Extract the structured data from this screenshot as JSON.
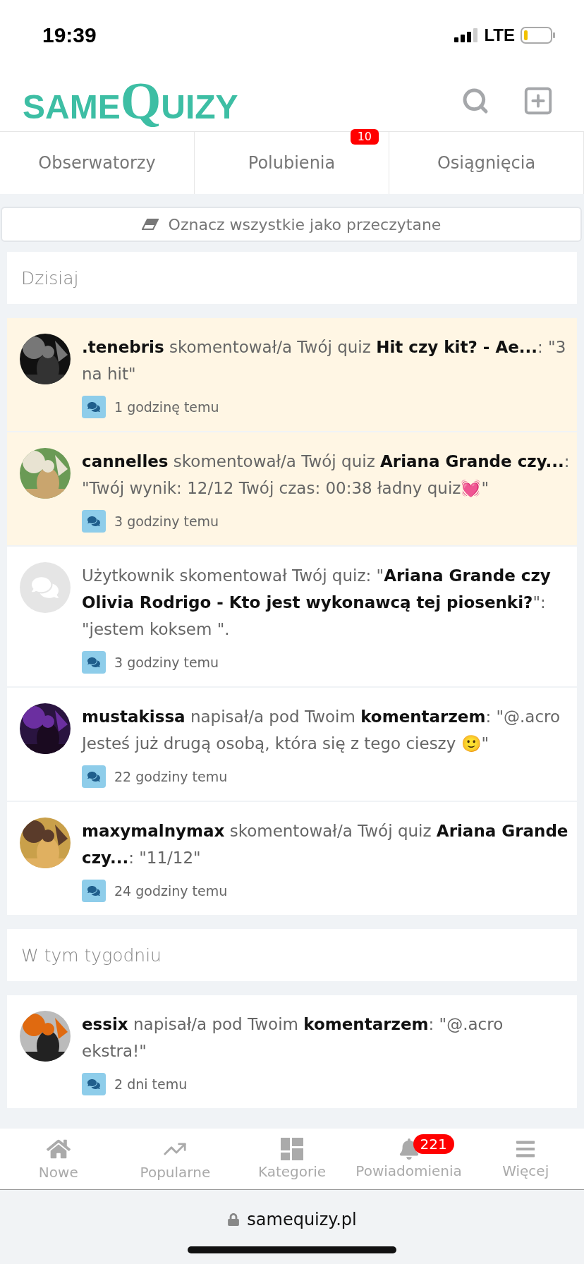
{
  "status_bar": {
    "time": "19:39",
    "network": "LTE"
  },
  "header": {
    "logo": [
      "SAME",
      "Q",
      "UIZY"
    ]
  },
  "tabs": [
    {
      "label": "Obserwatorzy",
      "selected": false
    },
    {
      "label": "Polubienia",
      "selected": false,
      "badge": "10"
    },
    {
      "label": "Osiągnięcia",
      "selected": false
    }
  ],
  "mark_all_button": "Oznacz wszystkie jako przeczytane",
  "sections": [
    {
      "title": "Dzisiaj",
      "items": [
        {
          "unread": true,
          "text": "**.tenebris** skomentował/a Twój quiz **Hit czy kit? - Ae...**: \"3 na hit\"",
          "time": "1 godzinę temu"
        },
        {
          "unread": true,
          "text": "**cannelles** skomentował/a Twój quiz **Ariana Grande czy...**: \"Twój wynik: 12/12 Twój czas: 00:38 ładny quiz💓\"",
          "time": "3 godziny temu"
        },
        {
          "avatar": {
            "kind": "placeholder"
          },
          "unread": false,
          "text": "Użytkownik skomentował Twój quiz: \"**Ariana Grande czy Olivia Rodrigo - Kto jest wykonawcą tej piosenki?**\": \"jestem koksem \".",
          "time": "3 godziny temu"
        },
        {
          "unread": false,
          "text": "**mustakissa** napisał/a pod Twoim **komentarzem**: \"@.acro Jesteś już drugą osobą, która się z tego cieszy 🙂\"",
          "time": "22 godziny temu"
        },
        {
          "unread": false,
          "text": "**maxymalnymax** skomentował/a Twój quiz **Ariana Grande czy...**: \"11/12\"",
          "time": "24 godziny temu"
        }
      ]
    },
    {
      "title": "W tym tygodniu",
      "items": [
        {
          "unread": false,
          "text": "**essix** napisał/a pod Twoim **komentarzem**: \"@.acro ekstra!\"",
          "time": "2 dni temu"
        }
      ]
    }
  ],
  "bottom_nav": [
    {
      "label": "Nowe",
      "selected": false
    },
    {
      "label": "Popularne",
      "selected": false
    },
    {
      "label": "Kategorie",
      "selected": false
    },
    {
      "label": "Powiadomienia",
      "selected": false,
      "badge": "221"
    },
    {
      "label": "Więcej",
      "selected": false
    }
  ],
  "browser_bar": {
    "url": "samequizy.pl"
  }
}
